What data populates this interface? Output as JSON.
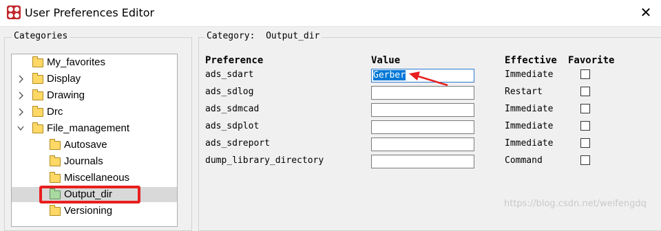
{
  "window": {
    "title": "User Preferences Editor"
  },
  "categories_panel": {
    "label": "Categories",
    "items": [
      {
        "label": "My_favorites",
        "expander": "none"
      },
      {
        "label": "Display",
        "expander": "collapsed"
      },
      {
        "label": "Drawing",
        "expander": "collapsed"
      },
      {
        "label": "Drc",
        "expander": "collapsed"
      },
      {
        "label": "File_management",
        "expander": "expanded"
      },
      {
        "label": "Autosave",
        "expander": "none"
      },
      {
        "label": "Journals",
        "expander": "none"
      },
      {
        "label": "Miscellaneous",
        "expander": "none"
      },
      {
        "label": "Output_dir",
        "expander": "none",
        "selected": true
      },
      {
        "label": "Versioning",
        "expander": "none"
      }
    ]
  },
  "category_panel": {
    "label": "Category:  Output_dir",
    "headers": {
      "preference": "Preference",
      "value": "Value",
      "effective": "Effective",
      "favorite": "Favorite"
    },
    "rows": [
      {
        "name": "ads_sdart",
        "value": "Gerber",
        "effective": "Immediate",
        "favorite": false
      },
      {
        "name": "ads_sdlog",
        "value": "",
        "effective": "Restart",
        "favorite": false
      },
      {
        "name": "ads_sdmcad",
        "value": "",
        "effective": "Immediate",
        "favorite": false
      },
      {
        "name": "ads_sdplot",
        "value": "",
        "effective": "Immediate",
        "favorite": false
      },
      {
        "name": "ads_sdreport",
        "value": "",
        "effective": "Immediate",
        "favorite": false
      },
      {
        "name": "dump_library_directory",
        "value": "",
        "effective": "Command",
        "favorite": false
      }
    ]
  },
  "watermark": "https://blog.csdn.net/weifengdq",
  "colors": {
    "highlight_box": "#e81f1f",
    "arrow": "#e81f1f",
    "selection": "#0078d7",
    "app_icon": "#c0282d"
  },
  "icons": {
    "app": "app-logo-icon",
    "close": "close-icon",
    "folder": "folder-icon",
    "chevron": "chevron-icon"
  }
}
